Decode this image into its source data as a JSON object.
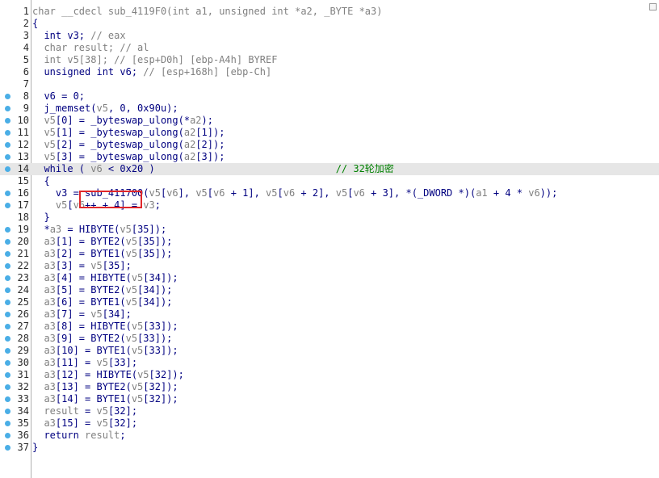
{
  "lines": [
    {
      "num": "1",
      "bp": false,
      "hl": false,
      "segs": [
        [
          "g",
          "char __cdecl sub_4119F0(int a1, unsigned int *a2, _BYTE *a3)"
        ]
      ]
    },
    {
      "num": "2",
      "bp": false,
      "hl": false,
      "segs": [
        [
          "n",
          "{"
        ]
      ]
    },
    {
      "num": "3",
      "bp": false,
      "hl": false,
      "segs": [
        [
          "n",
          "  int v3; "
        ],
        [
          "g",
          "// eax"
        ]
      ]
    },
    {
      "num": "4",
      "bp": false,
      "hl": false,
      "segs": [
        [
          "n",
          "  "
        ],
        [
          "g",
          "char result; // al"
        ]
      ]
    },
    {
      "num": "5",
      "bp": false,
      "hl": false,
      "segs": [
        [
          "n",
          "  "
        ],
        [
          "g",
          "int v5[38]; // [esp+D0h] [ebp-A4h] BYREF"
        ]
      ]
    },
    {
      "num": "6",
      "bp": false,
      "hl": false,
      "segs": [
        [
          "n",
          "  unsigned int v6; "
        ],
        [
          "g",
          "// [esp+168h] [ebp-Ch]"
        ]
      ]
    },
    {
      "num": "7",
      "bp": false,
      "hl": false,
      "segs": [
        [
          "n",
          ""
        ]
      ]
    },
    {
      "num": "8",
      "bp": true,
      "hl": false,
      "segs": [
        [
          "n",
          "  v6 = 0;"
        ]
      ]
    },
    {
      "num": "9",
      "bp": true,
      "hl": false,
      "segs": [
        [
          "n",
          "  j_memset("
        ],
        [
          "g",
          "v5"
        ],
        [
          "n",
          ", 0, 0x90u);"
        ]
      ]
    },
    {
      "num": "10",
      "bp": true,
      "hl": false,
      "segs": [
        [
          "n",
          "  "
        ],
        [
          "g",
          "v5"
        ],
        [
          "n",
          "[0] = _byteswap_ulong(*"
        ],
        [
          "g",
          "a2"
        ],
        [
          "n",
          ");"
        ]
      ]
    },
    {
      "num": "11",
      "bp": true,
      "hl": false,
      "segs": [
        [
          "n",
          "  "
        ],
        [
          "g",
          "v5"
        ],
        [
          "n",
          "[1] = _byteswap_ulong("
        ],
        [
          "g",
          "a2"
        ],
        [
          "n",
          "[1]);"
        ]
      ]
    },
    {
      "num": "12",
      "bp": true,
      "hl": false,
      "segs": [
        [
          "n",
          "  "
        ],
        [
          "g",
          "v5"
        ],
        [
          "n",
          "[2] = _byteswap_ulong("
        ],
        [
          "g",
          "a2"
        ],
        [
          "n",
          "[2]);"
        ]
      ]
    },
    {
      "num": "13",
      "bp": true,
      "hl": false,
      "segs": [
        [
          "n",
          "  "
        ],
        [
          "g",
          "v5"
        ],
        [
          "n",
          "[3] = _byteswap_ulong("
        ],
        [
          "g",
          "a2"
        ],
        [
          "n",
          "[3]);"
        ]
      ]
    },
    {
      "num": "14",
      "bp": true,
      "hl": true,
      "segs": [
        [
          "n",
          "  while ( "
        ],
        [
          "g",
          "v6"
        ],
        [
          "n",
          " < 0x20 )                               "
        ],
        [
          "c",
          "// 32轮加密"
        ]
      ]
    },
    {
      "num": "15",
      "bp": false,
      "hl": false,
      "segs": [
        [
          "n",
          "  {"
        ]
      ]
    },
    {
      "num": "16",
      "bp": true,
      "hl": false,
      "segs": [
        [
          "n",
          "    v3 = sub_411700("
        ],
        [
          "g",
          "v5"
        ],
        [
          "n",
          "["
        ],
        [
          "g",
          "v6"
        ],
        [
          "n",
          "], "
        ],
        [
          "g",
          "v5"
        ],
        [
          "n",
          "["
        ],
        [
          "g",
          "v6"
        ],
        [
          "n",
          " + 1], "
        ],
        [
          "g",
          "v5"
        ],
        [
          "n",
          "["
        ],
        [
          "g",
          "v6"
        ],
        [
          "n",
          " + 2], "
        ],
        [
          "g",
          "v5"
        ],
        [
          "n",
          "["
        ],
        [
          "g",
          "v6"
        ],
        [
          "n",
          " + 3], *(_DWORD *)("
        ],
        [
          "g",
          "a1"
        ],
        [
          "n",
          " + 4 * "
        ],
        [
          "g",
          "v6"
        ],
        [
          "n",
          "));"
        ]
      ]
    },
    {
      "num": "17",
      "bp": true,
      "hl": false,
      "segs": [
        [
          "n",
          "    "
        ],
        [
          "g",
          "v5"
        ],
        [
          "n",
          "["
        ],
        [
          "g",
          "v6"
        ],
        [
          "n",
          "++ + 4] = "
        ],
        [
          "g",
          "v3"
        ],
        [
          "n",
          ";"
        ]
      ]
    },
    {
      "num": "18",
      "bp": false,
      "hl": false,
      "segs": [
        [
          "n",
          "  }"
        ]
      ]
    },
    {
      "num": "19",
      "bp": true,
      "hl": false,
      "segs": [
        [
          "n",
          "  *"
        ],
        [
          "g",
          "a3"
        ],
        [
          "n",
          " = HIBYTE("
        ],
        [
          "g",
          "v5"
        ],
        [
          "n",
          "[35]);"
        ]
      ]
    },
    {
      "num": "20",
      "bp": true,
      "hl": false,
      "segs": [
        [
          "n",
          "  "
        ],
        [
          "g",
          "a3"
        ],
        [
          "n",
          "[1] = BYTE2("
        ],
        [
          "g",
          "v5"
        ],
        [
          "n",
          "[35]);"
        ]
      ]
    },
    {
      "num": "21",
      "bp": true,
      "hl": false,
      "segs": [
        [
          "n",
          "  "
        ],
        [
          "g",
          "a3"
        ],
        [
          "n",
          "[2] = BYTE1("
        ],
        [
          "g",
          "v5"
        ],
        [
          "n",
          "[35]);"
        ]
      ]
    },
    {
      "num": "22",
      "bp": true,
      "hl": false,
      "segs": [
        [
          "n",
          "  "
        ],
        [
          "g",
          "a3"
        ],
        [
          "n",
          "[3] = "
        ],
        [
          "g",
          "v5"
        ],
        [
          "n",
          "[35];"
        ]
      ]
    },
    {
      "num": "23",
      "bp": true,
      "hl": false,
      "segs": [
        [
          "n",
          "  "
        ],
        [
          "g",
          "a3"
        ],
        [
          "n",
          "[4] = HIBYTE("
        ],
        [
          "g",
          "v5"
        ],
        [
          "n",
          "[34]);"
        ]
      ]
    },
    {
      "num": "24",
      "bp": true,
      "hl": false,
      "segs": [
        [
          "n",
          "  "
        ],
        [
          "g",
          "a3"
        ],
        [
          "n",
          "[5] = BYTE2("
        ],
        [
          "g",
          "v5"
        ],
        [
          "n",
          "[34]);"
        ]
      ]
    },
    {
      "num": "25",
      "bp": true,
      "hl": false,
      "segs": [
        [
          "n",
          "  "
        ],
        [
          "g",
          "a3"
        ],
        [
          "n",
          "[6] = BYTE1("
        ],
        [
          "g",
          "v5"
        ],
        [
          "n",
          "[34]);"
        ]
      ]
    },
    {
      "num": "26",
      "bp": true,
      "hl": false,
      "segs": [
        [
          "n",
          "  "
        ],
        [
          "g",
          "a3"
        ],
        [
          "n",
          "[7] = "
        ],
        [
          "g",
          "v5"
        ],
        [
          "n",
          "[34];"
        ]
      ]
    },
    {
      "num": "27",
      "bp": true,
      "hl": false,
      "segs": [
        [
          "n",
          "  "
        ],
        [
          "g",
          "a3"
        ],
        [
          "n",
          "[8] = HIBYTE("
        ],
        [
          "g",
          "v5"
        ],
        [
          "n",
          "[33]);"
        ]
      ]
    },
    {
      "num": "28",
      "bp": true,
      "hl": false,
      "segs": [
        [
          "n",
          "  "
        ],
        [
          "g",
          "a3"
        ],
        [
          "n",
          "[9] = BYTE2("
        ],
        [
          "g",
          "v5"
        ],
        [
          "n",
          "[33]);"
        ]
      ]
    },
    {
      "num": "29",
      "bp": true,
      "hl": false,
      "segs": [
        [
          "n",
          "  "
        ],
        [
          "g",
          "a3"
        ],
        [
          "n",
          "[10] = BYTE1("
        ],
        [
          "g",
          "v5"
        ],
        [
          "n",
          "[33]);"
        ]
      ]
    },
    {
      "num": "30",
      "bp": true,
      "hl": false,
      "segs": [
        [
          "n",
          "  "
        ],
        [
          "g",
          "a3"
        ],
        [
          "n",
          "[11] = "
        ],
        [
          "g",
          "v5"
        ],
        [
          "n",
          "[33];"
        ]
      ]
    },
    {
      "num": "31",
      "bp": true,
      "hl": false,
      "segs": [
        [
          "n",
          "  "
        ],
        [
          "g",
          "a3"
        ],
        [
          "n",
          "[12] = HIBYTE("
        ],
        [
          "g",
          "v5"
        ],
        [
          "n",
          "[32]);"
        ]
      ]
    },
    {
      "num": "32",
      "bp": true,
      "hl": false,
      "segs": [
        [
          "n",
          "  "
        ],
        [
          "g",
          "a3"
        ],
        [
          "n",
          "[13] = BYTE2("
        ],
        [
          "g",
          "v5"
        ],
        [
          "n",
          "[32]);"
        ]
      ]
    },
    {
      "num": "33",
      "bp": true,
      "hl": false,
      "segs": [
        [
          "n",
          "  "
        ],
        [
          "g",
          "a3"
        ],
        [
          "n",
          "[14] = BYTE1("
        ],
        [
          "g",
          "v5"
        ],
        [
          "n",
          "[32]);"
        ]
      ]
    },
    {
      "num": "34",
      "bp": true,
      "hl": false,
      "segs": [
        [
          "n",
          "  "
        ],
        [
          "g",
          "result"
        ],
        [
          "n",
          " = "
        ],
        [
          "g",
          "v5"
        ],
        [
          "n",
          "[32];"
        ]
      ]
    },
    {
      "num": "35",
      "bp": true,
      "hl": false,
      "segs": [
        [
          "n",
          "  "
        ],
        [
          "g",
          "a3"
        ],
        [
          "n",
          "[15] = "
        ],
        [
          "g",
          "v5"
        ],
        [
          "n",
          "[32];"
        ]
      ]
    },
    {
      "num": "36",
      "bp": true,
      "hl": false,
      "segs": [
        [
          "n",
          "  return "
        ],
        [
          "g",
          "result"
        ],
        [
          "n",
          ";"
        ]
      ]
    },
    {
      "num": "37",
      "bp": true,
      "hl": false,
      "segs": [
        [
          "n",
          "}"
        ]
      ]
    }
  ],
  "colors": {
    "keyword": "#000080",
    "variable": "#808080",
    "comment": "#008000",
    "breakpoint": "#4aaee6",
    "highlight": "#e6e6e6",
    "annotation_box": "#e0262a"
  }
}
